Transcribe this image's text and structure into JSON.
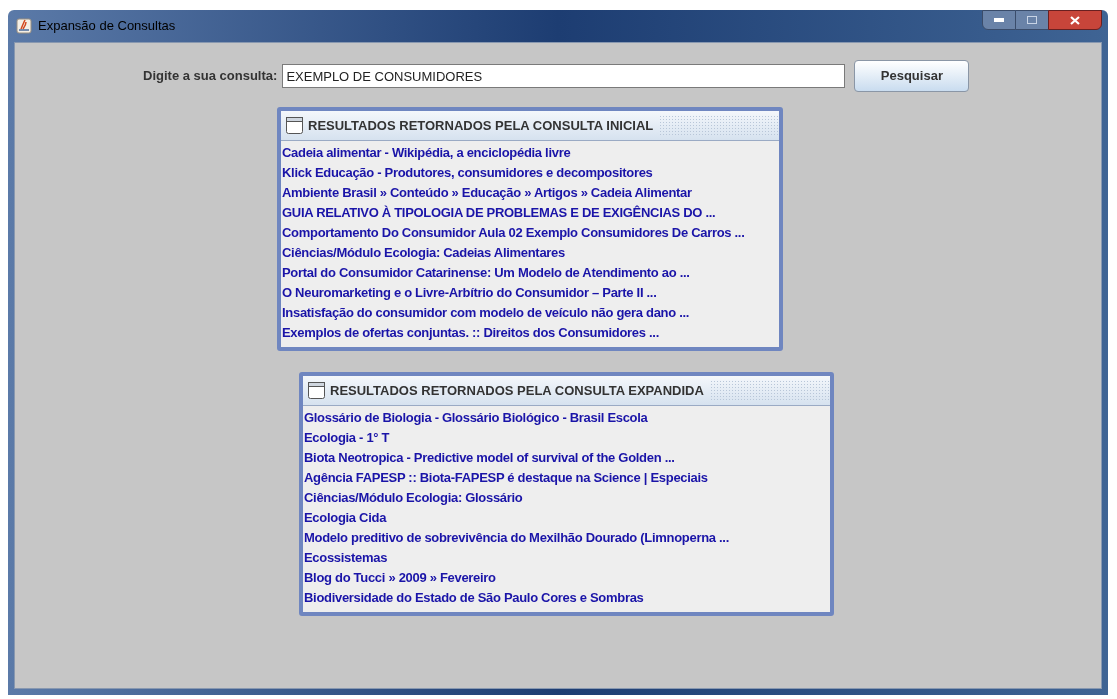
{
  "window": {
    "title": "Expansão de Consultas"
  },
  "search": {
    "label": "Digite a sua consulta:",
    "value": "EXEMPLO DE CONSUMIDORES",
    "button": "Pesquisar"
  },
  "panels": [
    {
      "title": "RESULTADOS RETORNADOS PELA CONSULTA INICIAL",
      "items": [
        "Cadeia alimentar - Wikipédia, a enciclopédia livre",
        "Klick Educação - Produtores, consumidores e decompositores",
        "Ambiente Brasil » Conteúdo » Educação » Artigos » Cadeia Alimentar",
        "GUIA RELATIVO À TIPOLOGIA DE PROBLEMAS E DE EXIGÊNCIAS DO ...",
        "Comportamento Do Consumidor Aula 02 Exemplo Consumidores De Carros ...",
        "Ciências/Módulo Ecologia: Cadeias Alimentares",
        "Portal do Consumidor Catarinense: Um Modelo de Atendimento ao ...",
        "O Neuromarketing e o Livre-Arbítrio do Consumidor – Parte II ...",
        "Insatisfação do consumidor com modelo de veículo não gera dano ...",
        "Exemplos de ofertas conjuntas. :: Direitos dos Consumidores ..."
      ]
    },
    {
      "title": "RESULTADOS RETORNADOS PELA CONSULTA EXPANDIDA",
      "items": [
        "Glossário de Biologia - Glossário Biológico - Brasil Escola",
        "Ecologia - 1° T",
        "Biota Neotropica - Predictive model of survival of the Golden ...",
        "Agência FAPESP :: Biota-FAPESP é destaque na Science | Especiais",
        "Ciências/Módulo Ecologia: Glossário",
        "Ecologia Cida",
        "Modelo preditivo de sobrevivência do Mexilhão Dourado (Limnoperna ...",
        "Ecossistemas",
        "Blog do Tucci » 2009 » Fevereiro",
        "Biodiversidade do Estado de São Paulo Cores e Sombras"
      ]
    }
  ]
}
